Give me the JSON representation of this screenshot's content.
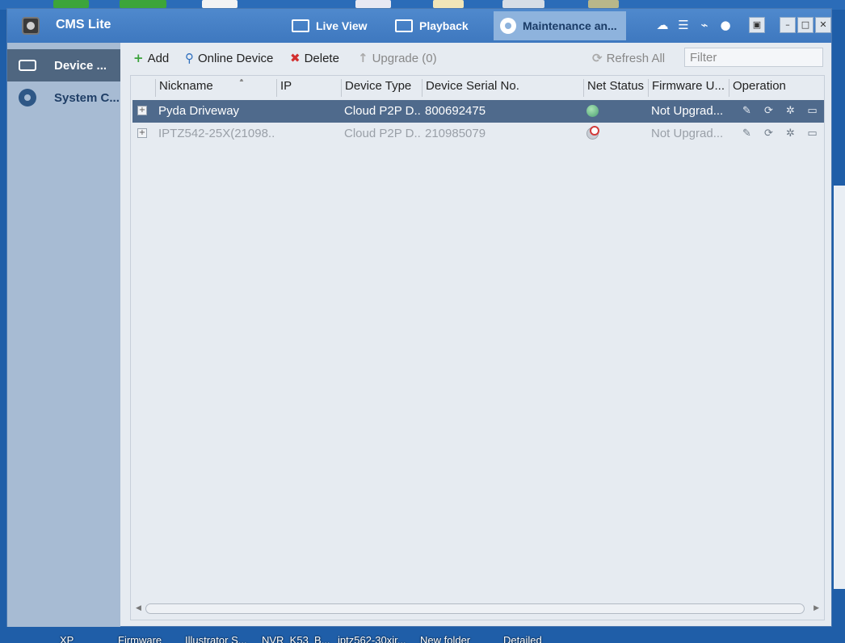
{
  "app": {
    "title": "CMS Lite"
  },
  "nav": {
    "tabs": [
      {
        "label": "Live View",
        "icon": "video-camera-icon",
        "active": false
      },
      {
        "label": "Playback",
        "icon": "film-icon",
        "active": false
      },
      {
        "label": "Maintenance an...",
        "icon": "gear-icon",
        "active": true
      }
    ]
  },
  "title_icons": [
    "cloud-check-icon",
    "list-icon",
    "activity-icon",
    "user-icon"
  ],
  "window_controls": [
    "lock-icon",
    "minimize-icon",
    "maximize-icon",
    "close-icon"
  ],
  "sidebar": {
    "items": [
      {
        "label": "Device ...",
        "icon": "drive-icon",
        "active": true
      },
      {
        "label": "System C...",
        "icon": "gear-icon",
        "active": false
      }
    ]
  },
  "toolbar": {
    "add_label": "Add",
    "online_device_label": "Online Device",
    "delete_label": "Delete",
    "upgrade_label": "Upgrade (0)",
    "refresh_label": "Refresh All",
    "filter_placeholder": "Filter"
  },
  "table": {
    "columns": [
      "Nickname",
      "IP",
      "Device Type",
      "Device Serial No.",
      "Net Status",
      "Firmware U...",
      "Operation"
    ],
    "rows": [
      {
        "nickname": "Pyda Driveway",
        "ip": "",
        "device_type": "Cloud P2P D...",
        "serial": "800692475",
        "net_status": "online",
        "firmware": "Not Upgrad...",
        "selected": true
      },
      {
        "nickname": "IPTZ542-25X(21098...",
        "ip": "",
        "device_type": "Cloud P2P D...",
        "serial": "210985079",
        "net_status": "offline",
        "firmware": "Not Upgrad...",
        "selected": false
      }
    ],
    "operation_icons": [
      "edit-icon",
      "refresh-icon",
      "settings-icon",
      "storage-icon"
    ]
  },
  "desktop": {
    "taskbar_labels": [
      "XP",
      "Firmware",
      "Illustrator S...",
      "NVR_K53_B...",
      "iptz562-30xir...",
      "New folder",
      "Detailed"
    ]
  },
  "colors": {
    "titlebar": "#4f89cd",
    "active_tab": "#8eb3dd",
    "sidebar": "#a7bbd3",
    "sidebar_active": "#4f6680",
    "selected_row": "#4f6a8c",
    "content_bg": "#e6ebf1"
  }
}
